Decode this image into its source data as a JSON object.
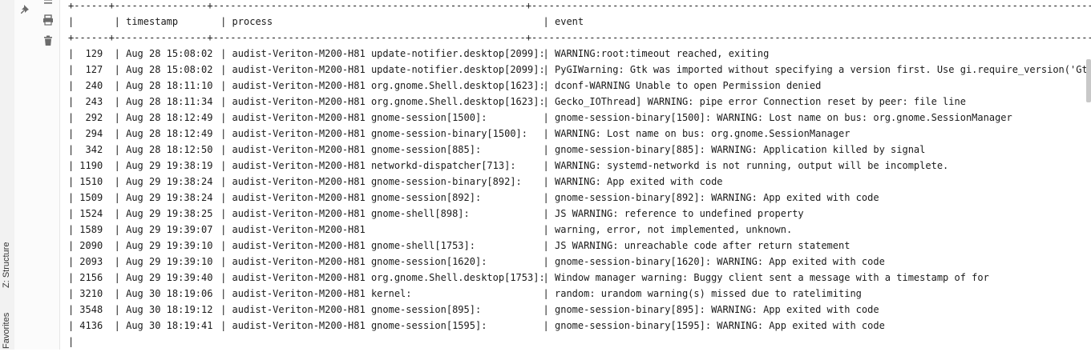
{
  "side_panel": {
    "structure_tab": "Z: Structure",
    "favorites_tab": "Favorites"
  },
  "toolbar": {
    "pin_icon": "pin-icon",
    "scroll_icon": "soft-wrap-icon",
    "print_icon": "print-icon",
    "trash_icon": "trash-icon"
  },
  "table": {
    "headers": {
      "index": "",
      "timestamp": "timestamp",
      "process": "process",
      "event": "event"
    },
    "rows": [
      {
        "index": "129",
        "timestamp": "Aug 28 15:08:02",
        "process": "audist-Veriton-M200-H81 update-notifier.desktop[2099]:",
        "event": "WARNING:root:timeout reached, exiting"
      },
      {
        "index": "127",
        "timestamp": "Aug 28 15:08:02",
        "process": "audist-Veriton-M200-H81 update-notifier.desktop[2099]:",
        "event": "PyGIWarning: Gtk was imported without specifying a version first. Use gi.require_version('Gtk', be"
      },
      {
        "index": "240",
        "timestamp": "Aug 28 18:11:10",
        "process": "audist-Veriton-M200-H81 org.gnome.Shell.desktop[1623]:",
        "event": "dconf-WARNING Unable to open Permission denied"
      },
      {
        "index": "243",
        "timestamp": "Aug 28 18:11:34",
        "process": "audist-Veriton-M200-H81 org.gnome.Shell.desktop[1623]:",
        "event": "Gecko_IOThread] WARNING: pipe error Connection reset by peer: file line"
      },
      {
        "index": "292",
        "timestamp": "Aug 28 18:12:49",
        "process": "audist-Veriton-M200-H81 gnome-session[1500]:",
        "event": "gnome-session-binary[1500]: WARNING: Lost name on bus: org.gnome.SessionManager"
      },
      {
        "index": "294",
        "timestamp": "Aug 28 18:12:49",
        "process": "audist-Veriton-M200-H81 gnome-session-binary[1500]:",
        "event": "WARNING: Lost name on bus: org.gnome.SessionManager"
      },
      {
        "index": "342",
        "timestamp": "Aug 28 18:12:50",
        "process": "audist-Veriton-M200-H81 gnome-session[885]:",
        "event": "gnome-session-binary[885]: WARNING: Application killed by signal"
      },
      {
        "index": "1190",
        "timestamp": "Aug 29 19:38:19",
        "process": "audist-Veriton-M200-H81 networkd-dispatcher[713]:",
        "event": "WARNING: systemd-networkd is not running, output will be incomplete."
      },
      {
        "index": "1510",
        "timestamp": "Aug 29 19:38:24",
        "process": "audist-Veriton-M200-H81 gnome-session-binary[892]:",
        "event": "WARNING: App exited with code"
      },
      {
        "index": "1509",
        "timestamp": "Aug 29 19:38:24",
        "process": "audist-Veriton-M200-H81 gnome-session[892]:",
        "event": "gnome-session-binary[892]: WARNING: App exited with code"
      },
      {
        "index": "1524",
        "timestamp": "Aug 29 19:38:25",
        "process": "audist-Veriton-M200-H81 gnome-shell[898]:",
        "event": "JS WARNING: reference to undefined property"
      },
      {
        "index": "1589",
        "timestamp": "Aug 29 19:39:07",
        "process": "audist-Veriton-M200-H81",
        "event": "warning, error, not implemented, unknown."
      },
      {
        "index": "2090",
        "timestamp": "Aug 29 19:39:10",
        "process": "audist-Veriton-M200-H81 gnome-shell[1753]:",
        "event": "JS WARNING: unreachable code after return statement"
      },
      {
        "index": "2093",
        "timestamp": "Aug 29 19:39:10",
        "process": "audist-Veriton-M200-H81 gnome-session[1620]:",
        "event": "gnome-session-binary[1620]: WARNING: App exited with code"
      },
      {
        "index": "2156",
        "timestamp": "Aug 29 19:39:40",
        "process": "audist-Veriton-M200-H81 org.gnome.Shell.desktop[1753]:",
        "event": "Window manager warning: Buggy client sent a message with a timestamp of for"
      },
      {
        "index": "3210",
        "timestamp": "Aug 30 18:19:06",
        "process": "audist-Veriton-M200-H81 kernel:",
        "event": "random: urandom warning(s) missed due to ratelimiting"
      },
      {
        "index": "3548",
        "timestamp": "Aug 30 18:19:12",
        "process": "audist-Veriton-M200-H81 gnome-session[895]:",
        "event": "gnome-session-binary[895]: WARNING: App exited with code"
      },
      {
        "index": "4136",
        "timestamp": "Aug 30 18:19:41",
        "process": "audist-Veriton-M200-H81 gnome-session[1595]:",
        "event": "gnome-session-binary[1595]: WARNING: App exited with code"
      }
    ]
  },
  "colors": {
    "text": "#1a1a1a",
    "panel_bg": "#f2f2f2",
    "scrollbar": "#c8c8c8"
  }
}
